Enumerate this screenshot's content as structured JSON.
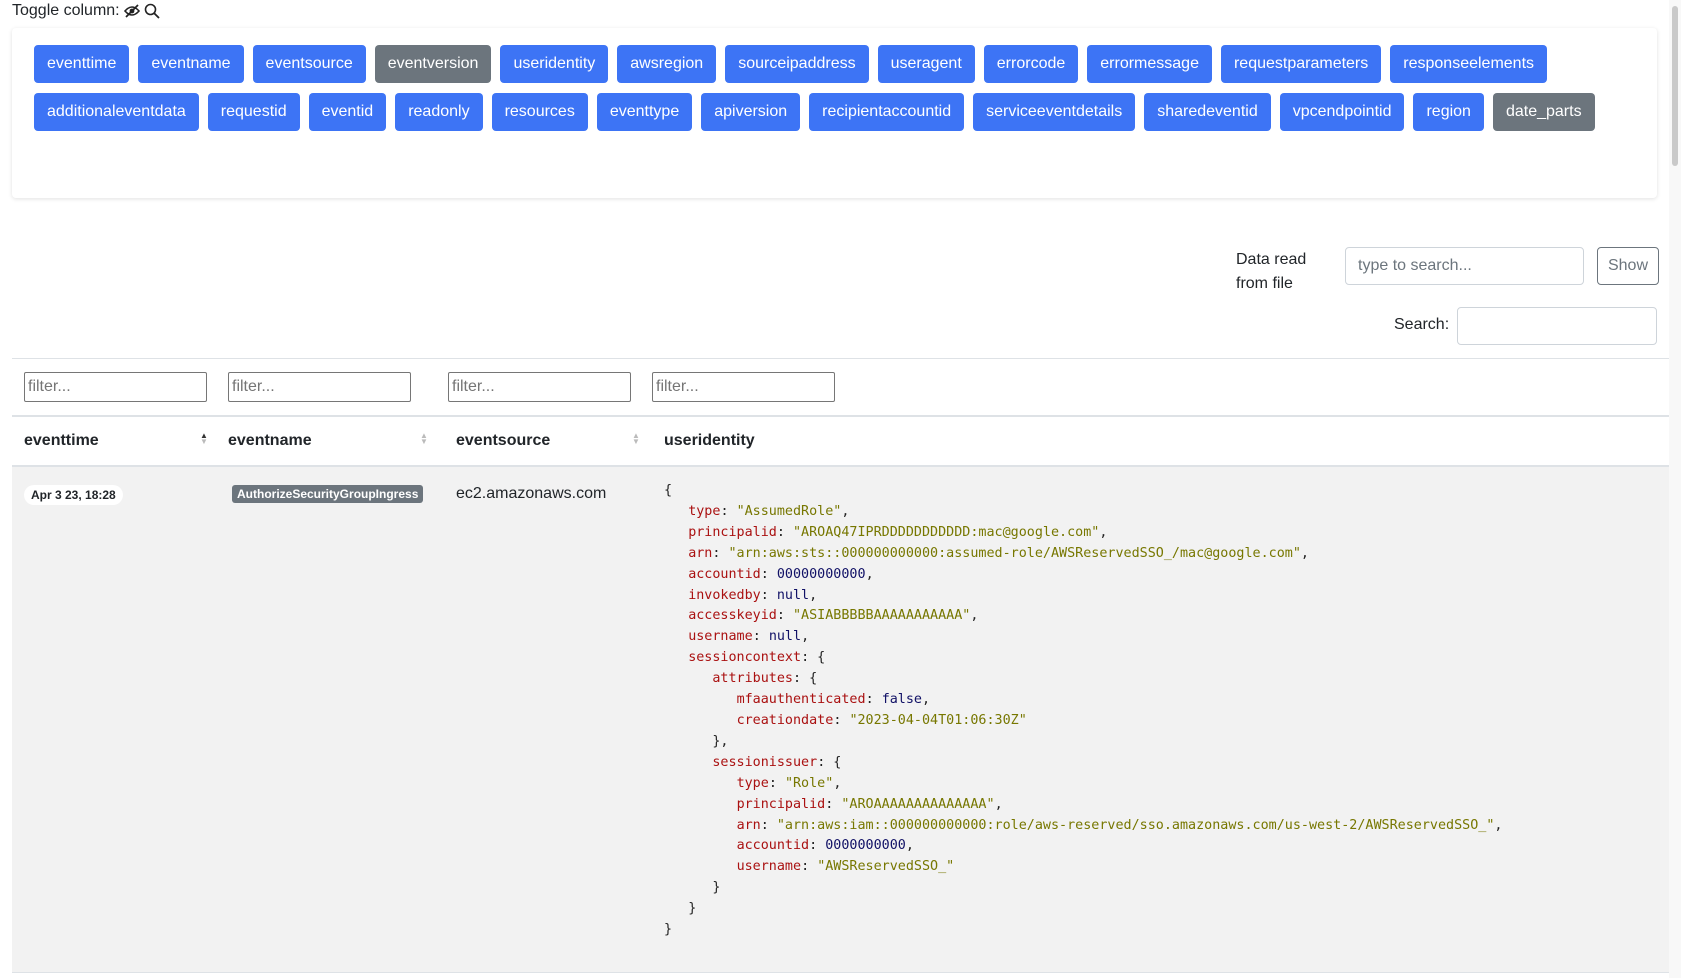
{
  "toggle": {
    "label": "Toggle column:",
    "columns": [
      {
        "label": "eventtime",
        "active": true
      },
      {
        "label": "eventname",
        "active": true
      },
      {
        "label": "eventsource",
        "active": true
      },
      {
        "label": "eventversion",
        "active": false
      },
      {
        "label": "useridentity",
        "active": true
      },
      {
        "label": "awsregion",
        "active": true
      },
      {
        "label": "sourceipaddress",
        "active": true
      },
      {
        "label": "useragent",
        "active": true
      },
      {
        "label": "errorcode",
        "active": true
      },
      {
        "label": "errormessage",
        "active": true
      },
      {
        "label": "requestparameters",
        "active": true
      },
      {
        "label": "responseelements",
        "active": true
      },
      {
        "label": "additionaleventdata",
        "active": true
      },
      {
        "label": "requestid",
        "active": true
      },
      {
        "label": "eventid",
        "active": true
      },
      {
        "label": "readonly",
        "active": true
      },
      {
        "label": "resources",
        "active": true
      },
      {
        "label": "eventtype",
        "active": true
      },
      {
        "label": "apiversion",
        "active": true
      },
      {
        "label": "recipientaccountid",
        "active": true
      },
      {
        "label": "serviceeventdetails",
        "active": true
      },
      {
        "label": "sharedeventid",
        "active": true
      },
      {
        "label": "vpcendpointid",
        "active": true
      },
      {
        "label": "region",
        "active": true
      },
      {
        "label": "date_parts",
        "active": false
      }
    ]
  },
  "file_search": {
    "label": "Data read from file",
    "placeholder": "type to search...",
    "button": "Show"
  },
  "table_search": {
    "label": "Search:"
  },
  "table": {
    "filter_placeholder": "filter...",
    "headers": [
      "eventtime",
      "eventname",
      "eventsource",
      "useridentity"
    ],
    "row": {
      "eventtime": "Apr 3 23, 18:28",
      "eventname": "AuthorizeSecurityGroupIngress",
      "eventsource": "ec2.amazonaws.com",
      "useridentity": [
        [
          0,
          [
            [
              "p",
              "{"
            ]
          ]
        ],
        [
          1,
          [
            [
              "k",
              "type"
            ],
            [
              "p",
              ": "
            ],
            [
              "s",
              "\"AssumedRole\""
            ],
            [
              "p",
              ","
            ]
          ]
        ],
        [
          1,
          [
            [
              "k",
              "principalid"
            ],
            [
              "p",
              ": "
            ],
            [
              "s",
              "\"AROAQ47IPRDDDDDDDDDDD:mac@google.com\""
            ],
            [
              "p",
              ","
            ]
          ]
        ],
        [
          1,
          [
            [
              "k",
              "arn"
            ],
            [
              "p",
              ": "
            ],
            [
              "s",
              "\"arn:aws:sts::000000000000:assumed-role/AWSReservedSSO_/mac@google.com\""
            ],
            [
              "p",
              ","
            ]
          ]
        ],
        [
          1,
          [
            [
              "k",
              "accountid"
            ],
            [
              "p",
              ": "
            ],
            [
              "n",
              "00000000000"
            ],
            [
              "p",
              ","
            ]
          ]
        ],
        [
          1,
          [
            [
              "k",
              "invokedby"
            ],
            [
              "p",
              ": "
            ],
            [
              "n",
              "null"
            ],
            [
              "p",
              ","
            ]
          ]
        ],
        [
          1,
          [
            [
              "k",
              "accesskeyid"
            ],
            [
              "p",
              ": "
            ],
            [
              "s",
              "\"ASIABBBBBAAAAAAAAAAA\""
            ],
            [
              "p",
              ","
            ]
          ]
        ],
        [
          1,
          [
            [
              "k",
              "username"
            ],
            [
              "p",
              ": "
            ],
            [
              "n",
              "null"
            ],
            [
              "p",
              ","
            ]
          ]
        ],
        [
          1,
          [
            [
              "k",
              "sessioncontext"
            ],
            [
              "p",
              ": {"
            ]
          ]
        ],
        [
          2,
          [
            [
              "k",
              "attributes"
            ],
            [
              "p",
              ": {"
            ]
          ]
        ],
        [
          3,
          [
            [
              "k",
              "mfaauthenticated"
            ],
            [
              "p",
              ": "
            ],
            [
              "n",
              "false"
            ],
            [
              "p",
              ","
            ]
          ]
        ],
        [
          3,
          [
            [
              "k",
              "creationdate"
            ],
            [
              "p",
              ": "
            ],
            [
              "s",
              "\"2023-04-04T01:06:30Z\""
            ]
          ]
        ],
        [
          2,
          [
            [
              "p",
              "},"
            ]
          ]
        ],
        [
          2,
          [
            [
              "k",
              "sessionissuer"
            ],
            [
              "p",
              ": {"
            ]
          ]
        ],
        [
          3,
          [
            [
              "k",
              "type"
            ],
            [
              "p",
              ": "
            ],
            [
              "s",
              "\"Role\""
            ],
            [
              "p",
              ","
            ]
          ]
        ],
        [
          3,
          [
            [
              "k",
              "principalid"
            ],
            [
              "p",
              ": "
            ],
            [
              "s",
              "\"AROAAAAAAAAAAAAAA\""
            ],
            [
              "p",
              ","
            ]
          ]
        ],
        [
          3,
          [
            [
              "k",
              "arn"
            ],
            [
              "p",
              ": "
            ],
            [
              "s",
              "\"arn:aws:iam::000000000000:role/aws-reserved/sso.amazonaws.com/us-west-2/AWSReservedSSO_\""
            ],
            [
              "p",
              ","
            ]
          ]
        ],
        [
          3,
          [
            [
              "k",
              "accountid"
            ],
            [
              "p",
              ": "
            ],
            [
              "n",
              "0000000000"
            ],
            [
              "p",
              ","
            ]
          ]
        ],
        [
          3,
          [
            [
              "k",
              "username"
            ],
            [
              "p",
              ": "
            ],
            [
              "s",
              "\"AWSReservedSSO_\""
            ]
          ]
        ],
        [
          2,
          [
            [
              "p",
              "}"
            ]
          ]
        ],
        [
          1,
          [
            [
              "p",
              "}"
            ]
          ]
        ],
        [
          0,
          [
            [
              "p",
              "}"
            ]
          ]
        ]
      ]
    }
  },
  "colors": {
    "button_active": "#3d74f5",
    "button_inactive": "#6c757d",
    "json_key": "#aa1111",
    "json_string": "#777700",
    "json_number": "#111166"
  }
}
